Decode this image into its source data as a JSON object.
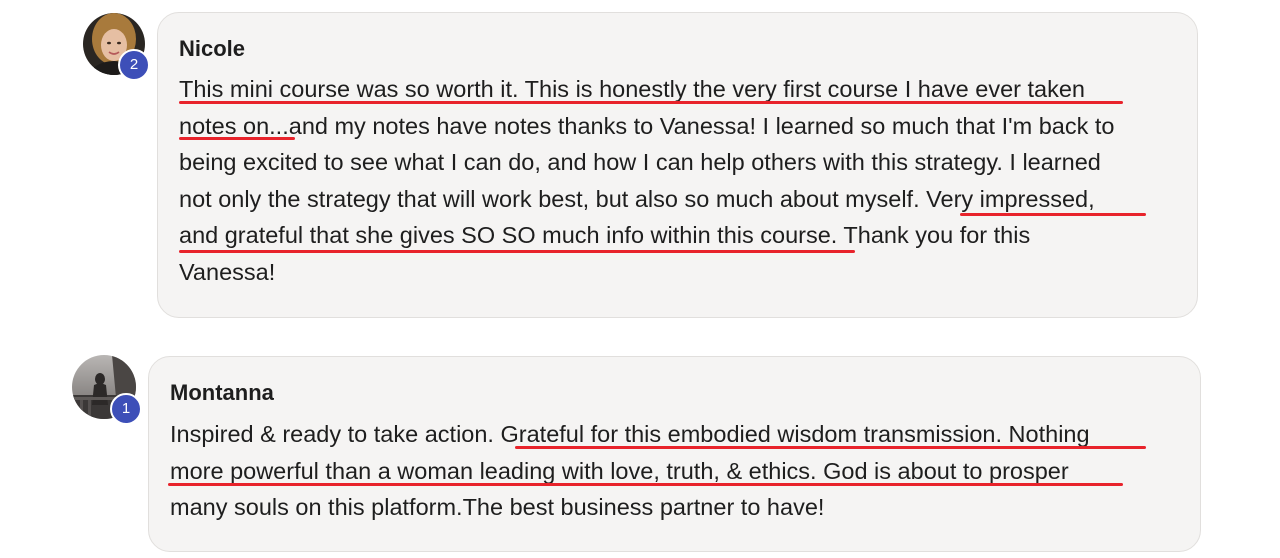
{
  "comments": [
    {
      "author": "Nicole",
      "badge_count": "2",
      "lines": [
        "This mini course was so worth it. This is honestly the very first course I have ever taken",
        "notes on...and my notes have notes thanks to Vanessa! I learned so much that I'm back to",
        "being excited to see what I can do, and how I can help others with this strategy. I learned",
        "not only the strategy that will work best, but also so much about myself. Very impressed,",
        "and grateful that she gives SO SO much info within this course. Thank you for this",
        "Vanessa!"
      ],
      "underline_color": "#e8232b"
    },
    {
      "author": "Montanna",
      "badge_count": "1",
      "lines": [
        "Inspired & ready to take action. Grateful for this embodied wisdom transmission. Nothing",
        "more powerful than a woman leading with love, truth, & ethics. God is about to prosper",
        "many souls on this platform.The best business partner to have!"
      ],
      "underline_color": "#e8232b"
    }
  ],
  "colors": {
    "badge": "#3d4fb8",
    "bubble_background": "#f5f4f3",
    "underline": "#e8232b"
  }
}
